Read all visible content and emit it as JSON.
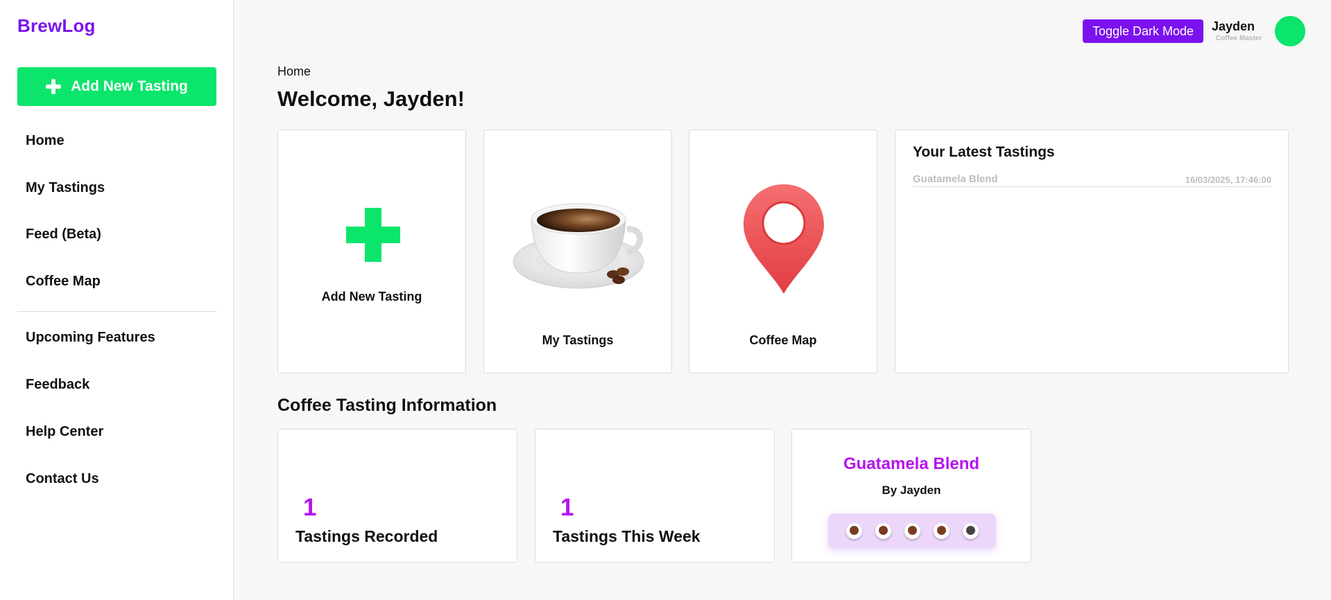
{
  "app": {
    "logo": "BrewLog"
  },
  "sidebar": {
    "add_button_label": "Add New Tasting",
    "items": [
      {
        "label": "Home"
      },
      {
        "label": "My Tastings"
      },
      {
        "label": "Feed (Beta)"
      },
      {
        "label": "Coffee Map"
      },
      {
        "label": "Upcoming Features"
      },
      {
        "label": "Feedback"
      },
      {
        "label": "Help Center"
      },
      {
        "label": "Contact Us"
      }
    ]
  },
  "header": {
    "toggle_label": "Toggle Dark Mode",
    "user_name": "Jayden",
    "user_role": "Coffee Master"
  },
  "main": {
    "breadcrumb": "Home",
    "title": "Welcome, Jayden!",
    "tiles": [
      {
        "label": "Add New Tasting",
        "icon": "plus-icon"
      },
      {
        "label": "My Tastings",
        "icon": "coffee-cup-icon"
      },
      {
        "label": "Coffee Map",
        "icon": "map-pin-icon"
      }
    ],
    "latest": {
      "title": "Your Latest Tastings",
      "rows": [
        {
          "name": "Guatamela Blend",
          "date": "16/03/2025, 17:46:00"
        }
      ]
    },
    "info": {
      "title": "Coffee Tasting Information",
      "stats": [
        {
          "value": "1",
          "label": "Tastings Recorded"
        },
        {
          "value": "1",
          "label": "Tastings This Week"
        }
      ],
      "featured": {
        "name": "Guatamela Blend",
        "by": "By Jayden",
        "rating": 4,
        "rating_max": 5
      }
    }
  },
  "colors": {
    "brand_purple": "#7b12ee",
    "accent_green": "#0be56b",
    "magenta": "#b514ee",
    "pin_red": "#ee4b4f",
    "bean_filled": "#7a3b22",
    "bean_empty": "#444444"
  }
}
